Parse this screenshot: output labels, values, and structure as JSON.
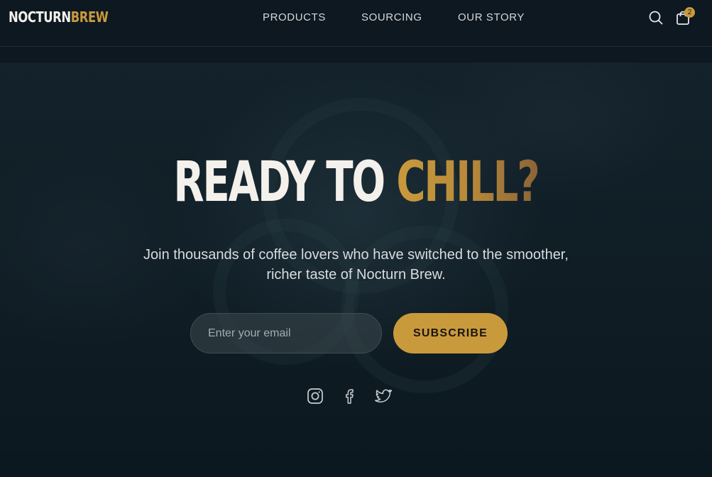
{
  "brand": {
    "part1": "NOCTURN",
    "part2": "BREW"
  },
  "nav": {
    "products": "PRODUCTS",
    "sourcing": "SOURCING",
    "our_story": "OUR STORY"
  },
  "cart": {
    "count": "2"
  },
  "hero": {
    "headline_white": "READY TO ",
    "headline_gold": "CHILL?",
    "subtitle_line1": "Join thousands of coffee lovers who have switched to the smoother,",
    "subtitle_line2": "richer taste of Nocturn Brew."
  },
  "form": {
    "email_placeholder": "Enter your email",
    "subscribe_label": "SUBSCRIBE"
  },
  "social": {
    "icons": [
      "instagram-icon",
      "facebook-icon",
      "twitter-icon"
    ]
  },
  "colors": {
    "accent": "#c99a3c",
    "background": "#0d1820"
  }
}
